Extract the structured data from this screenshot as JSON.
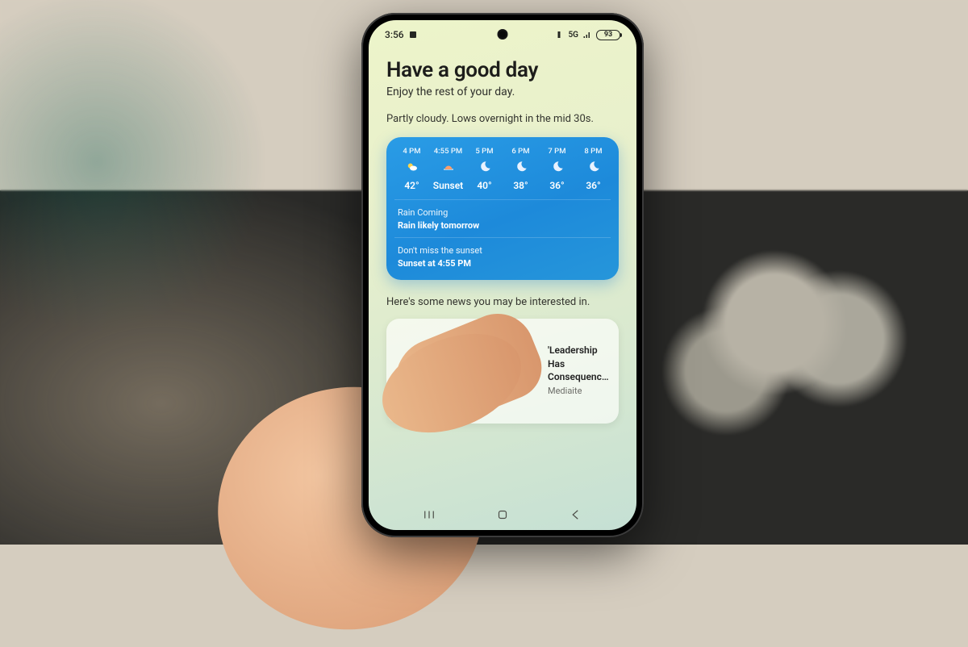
{
  "status": {
    "time": "3:56",
    "network": "5G",
    "battery": "93"
  },
  "greeting": {
    "title": "Have a good day",
    "subtitle": "Enjoy the rest of your day."
  },
  "weather": {
    "summary": "Partly cloudy. Lows overnight in the mid 30s.",
    "hours": [
      {
        "time": "4 PM",
        "icon": "partly-sunny",
        "value": "42°"
      },
      {
        "time": "4:55 PM",
        "icon": "sunset",
        "value": "Sunset"
      },
      {
        "time": "5 PM",
        "icon": "night",
        "value": "40°"
      },
      {
        "time": "6 PM",
        "icon": "night",
        "value": "38°"
      },
      {
        "time": "7 PM",
        "icon": "night",
        "value": "36°"
      },
      {
        "time": "8 PM",
        "icon": "night",
        "value": "36°"
      }
    ],
    "alerts": [
      {
        "heading": "Rain Coming",
        "detail": "Rain likely tomorrow"
      },
      {
        "heading": "Don't miss the sunset",
        "detail": "Sunset at 4:55 PM"
      }
    ]
  },
  "news": {
    "lede": "Here's some news you may be interested in.",
    "items": [
      {
        "title": "'Leadership Has Consequences': Kristi Noem Jabs Democrats O…",
        "source": "Mediaite"
      }
    ]
  }
}
